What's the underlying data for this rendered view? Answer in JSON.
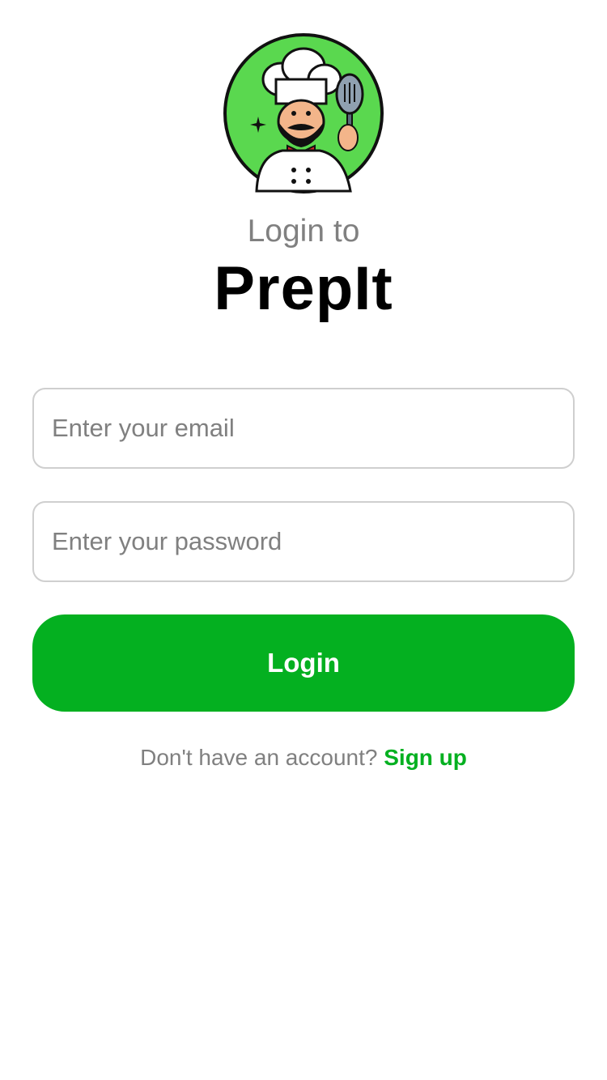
{
  "brand": {
    "logo_icon": "chef-mascot-icon",
    "accent_color": "#04b020"
  },
  "header": {
    "subtitle": "Login to",
    "app_name": "PrepIt"
  },
  "form": {
    "email_placeholder": "Enter your email",
    "email_value": "",
    "password_placeholder": "Enter your password",
    "password_value": "",
    "login_label": "Login"
  },
  "footer": {
    "signup_prompt": "Don't have an account?",
    "signup_link": "Sign up"
  }
}
